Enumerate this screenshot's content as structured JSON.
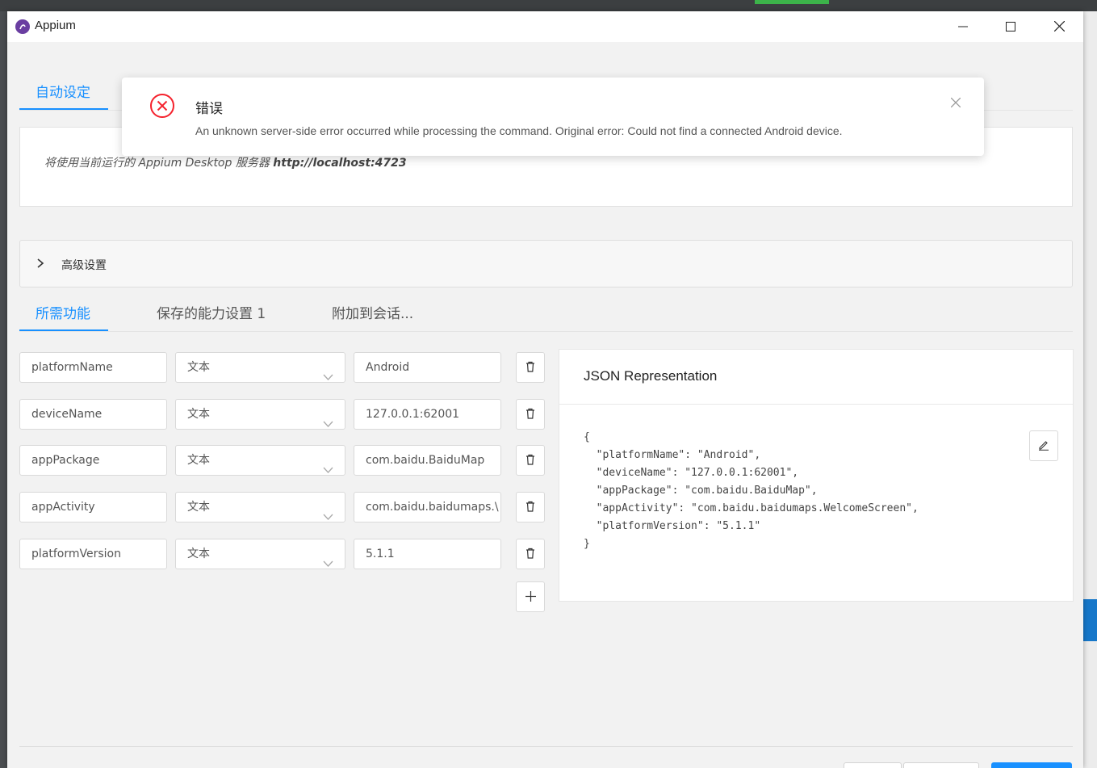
{
  "window": {
    "title": "Appium"
  },
  "top_tabs": [
    {
      "label": "自动设定",
      "active": true
    }
  ],
  "server_info": {
    "prefix": "将使用当前运行的 Appium Desktop 服务器",
    "url": "http://localhost:4723"
  },
  "advanced": {
    "label": "高级设置"
  },
  "cap_tabs": [
    {
      "label": "所需功能",
      "active": true
    },
    {
      "label": "保存的能力设置 1",
      "active": false
    },
    {
      "label": "附加到会话...",
      "active": false
    }
  ],
  "capabilities": [
    {
      "name": "platformName",
      "type": "文本",
      "value": "Android"
    },
    {
      "name": "deviceName",
      "type": "文本",
      "value": "127.0.0.1:62001"
    },
    {
      "name": "appPackage",
      "type": "文本",
      "value": "com.baidu.BaiduMap"
    },
    {
      "name": "appActivity",
      "type": "文本",
      "value": "com.baidu.baidumaps.\\"
    },
    {
      "name": "platformVersion",
      "type": "文本",
      "value": "5.1.1"
    }
  ],
  "json_panel": {
    "title": "JSON Representation",
    "body": "{\n  \"platformName\": \"Android\",\n  \"deviceName\": \"127.0.0.1:62001\",\n  \"appPackage\": \"com.baidu.BaiduMap\",\n  \"appActivity\": \"com.baidu.baidumaps.WelcomeScreen\",\n  \"platformVersion\": \"5.1.1\"\n}"
  },
  "notification": {
    "title": "错误",
    "message": "An unknown server-side error occurred while processing the command. Original error: Could not find a connected Android device."
  },
  "icons": {
    "app_logo": "appium-logo-icon",
    "minimize": "minimize-icon",
    "maximize": "maximize-icon",
    "close": "close-icon",
    "error": "error-circle-icon",
    "dismiss": "close-icon",
    "delete": "trash-icon",
    "add": "plus-icon",
    "edit": "edit-icon",
    "expand": "chevron-right-icon",
    "dropdown": "chevron-down-icon"
  },
  "colors": {
    "accent": "#1890ff",
    "error": "#f5222d",
    "brand": "#6a3ea1"
  }
}
